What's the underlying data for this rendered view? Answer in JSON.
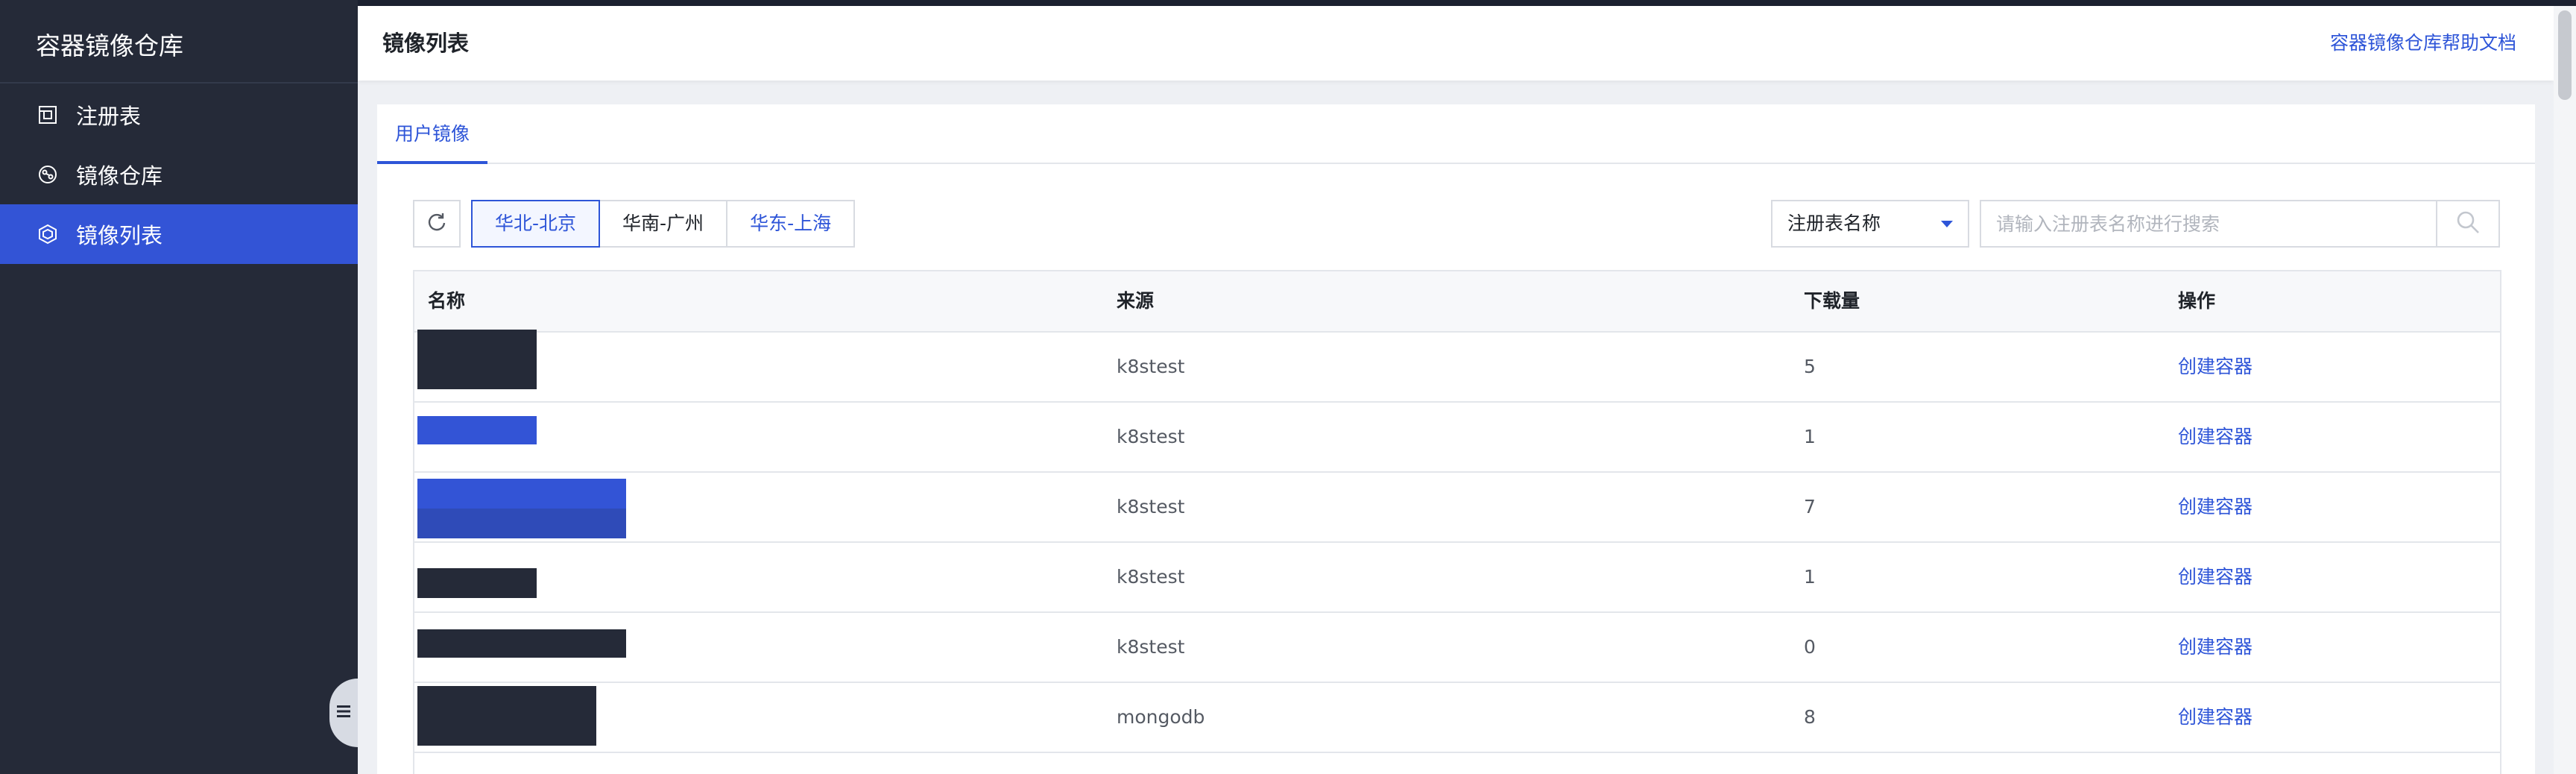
{
  "sidebar": {
    "brand": "容器镜像仓库",
    "items": [
      {
        "label": "注册表",
        "icon": "registry-icon"
      },
      {
        "label": "镜像仓库",
        "icon": "repository-icon"
      },
      {
        "label": "镜像列表",
        "icon": "image-list-icon",
        "active": true
      }
    ]
  },
  "header": {
    "title": "镜像列表",
    "help_link": "容器镜像仓库帮助文档"
  },
  "tabs": [
    {
      "label": "用户镜像",
      "active": true
    }
  ],
  "toolbar": {
    "refresh_icon": "refresh-icon",
    "regions": [
      {
        "label": "华北-北京",
        "selected": true
      },
      {
        "label": "华南-广州",
        "selected": false
      },
      {
        "label": "华东-上海",
        "selected": false
      }
    ],
    "filter_select": "注册表名称",
    "search_placeholder": "请输入注册表名称进行搜索",
    "search_icon": "search-icon"
  },
  "table": {
    "columns": [
      "名称",
      "来源",
      "下载量",
      "操作"
    ],
    "rows": [
      {
        "name": "",
        "source": "k8stest",
        "downloads": "5",
        "action": "创建容器"
      },
      {
        "name": "",
        "source": "k8stest",
        "downloads": "1",
        "action": "创建容器"
      },
      {
        "name": "",
        "source": "k8stest",
        "downloads": "7",
        "action": "创建容器"
      },
      {
        "name": "",
        "source": "k8stest",
        "downloads": "1",
        "action": "创建容器"
      },
      {
        "name": "",
        "source": "k8stest",
        "downloads": "0",
        "action": "创建容器"
      },
      {
        "name": "",
        "source": "mongodb",
        "downloads": "8",
        "action": "创建容器"
      }
    ]
  },
  "colors": {
    "sidebar_bg": "#252a38",
    "accent": "#3354d6",
    "link": "#2e55d8"
  }
}
